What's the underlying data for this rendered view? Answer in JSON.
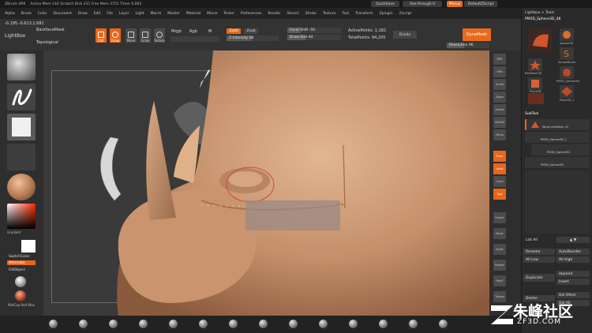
{
  "titlebar": {
    "app": "ZBrush 4R6",
    "stats": "Active Mem 144  Scratch Disk 231  Free Mem 3751  Timer 0.003",
    "quicksave": "QuickSave",
    "seethrough": "See-through  0",
    "menus_btn": "Menus",
    "script": "DefaultZScript"
  },
  "menubar": [
    "Alpha",
    "Brush",
    "Color",
    "Document",
    "Draw",
    "Edit",
    "File",
    "Layer",
    "Light",
    "Macro",
    "Marker",
    "Material",
    "Movie",
    "Picker",
    "Preferences",
    "Render",
    "Stencil",
    "Stroke",
    "Texture",
    "Tool",
    "Transform",
    "Zplugin",
    "Zscript"
  ],
  "toolbar": {
    "coords": "-0.195,-0.613,1.681",
    "backface": "BackfaceMask",
    "lightbox": "LightBox",
    "topological": "Topological",
    "edit": "Edit",
    "draw": "Draw",
    "move": "Move",
    "scale": "Scale",
    "rotate": "Rotate",
    "mrgb": "Mrgb",
    "rgb": "Rgb",
    "m": "M",
    "zadd": "Zadd",
    "zsub": "Zsub",
    "zintensity": "Z Intensity 48",
    "focal": "Focal Shift -50",
    "drawsize": "Draw Size 84",
    "active_points": "ActivePoints: 1,182",
    "total_points": "TotalPoints: 94,205",
    "divide": "Divide",
    "dynamesh": "DynaMesh",
    "resolution": "Resolution 96"
  },
  "leftshelf": {
    "gradient": "Gradient",
    "switchcolor": "SwitchColor",
    "alternate": "Alternate",
    "fillobject": "FillObject",
    "matcap": "MatCap Red Wax"
  },
  "rightshelf": [
    "BPR",
    "SPix",
    "Scroll",
    "Zoom",
    "Actual",
    "AAHalf",
    "Persp",
    "Floor",
    "Local",
    "LSym",
    "Xyz",
    "Frame",
    "Move",
    "Scale",
    "Rotate",
    "PolyF",
    "Transp"
  ],
  "panel": {
    "tool_title": "Lightbox > Tools",
    "current_tool": "PM3D_Sphere3D_48",
    "tools": [
      "Sphere3D",
      "SimpleBrush",
      "PolyMesh3D",
      "PM3D_Sphere3D",
      "Plane3D",
      "Plane3D_1"
    ],
    "subtool_title": "SubTool",
    "subtools": [
      "WireCurveMesh 10",
      "PM3D_Sphere3D_1",
      "PM3D_Sphere3D",
      "PM3D_Sphere3D"
    ],
    "listall": "List All",
    "rename": "Rename",
    "autoreorder": "AutoReorder",
    "alllow": "All Low",
    "allhigh": "All High",
    "duplicate": "Duplicate",
    "append": "Append",
    "insert": "Insert",
    "delete": "Delete",
    "delother": "Del Other",
    "delall": "Del All"
  },
  "watermark": {
    "cn": "朱峰社区",
    "en": "ZF3D.COM"
  },
  "colors": {
    "accent": "#e8661a",
    "skin": "#c89a78",
    "horn": "#b88862"
  }
}
